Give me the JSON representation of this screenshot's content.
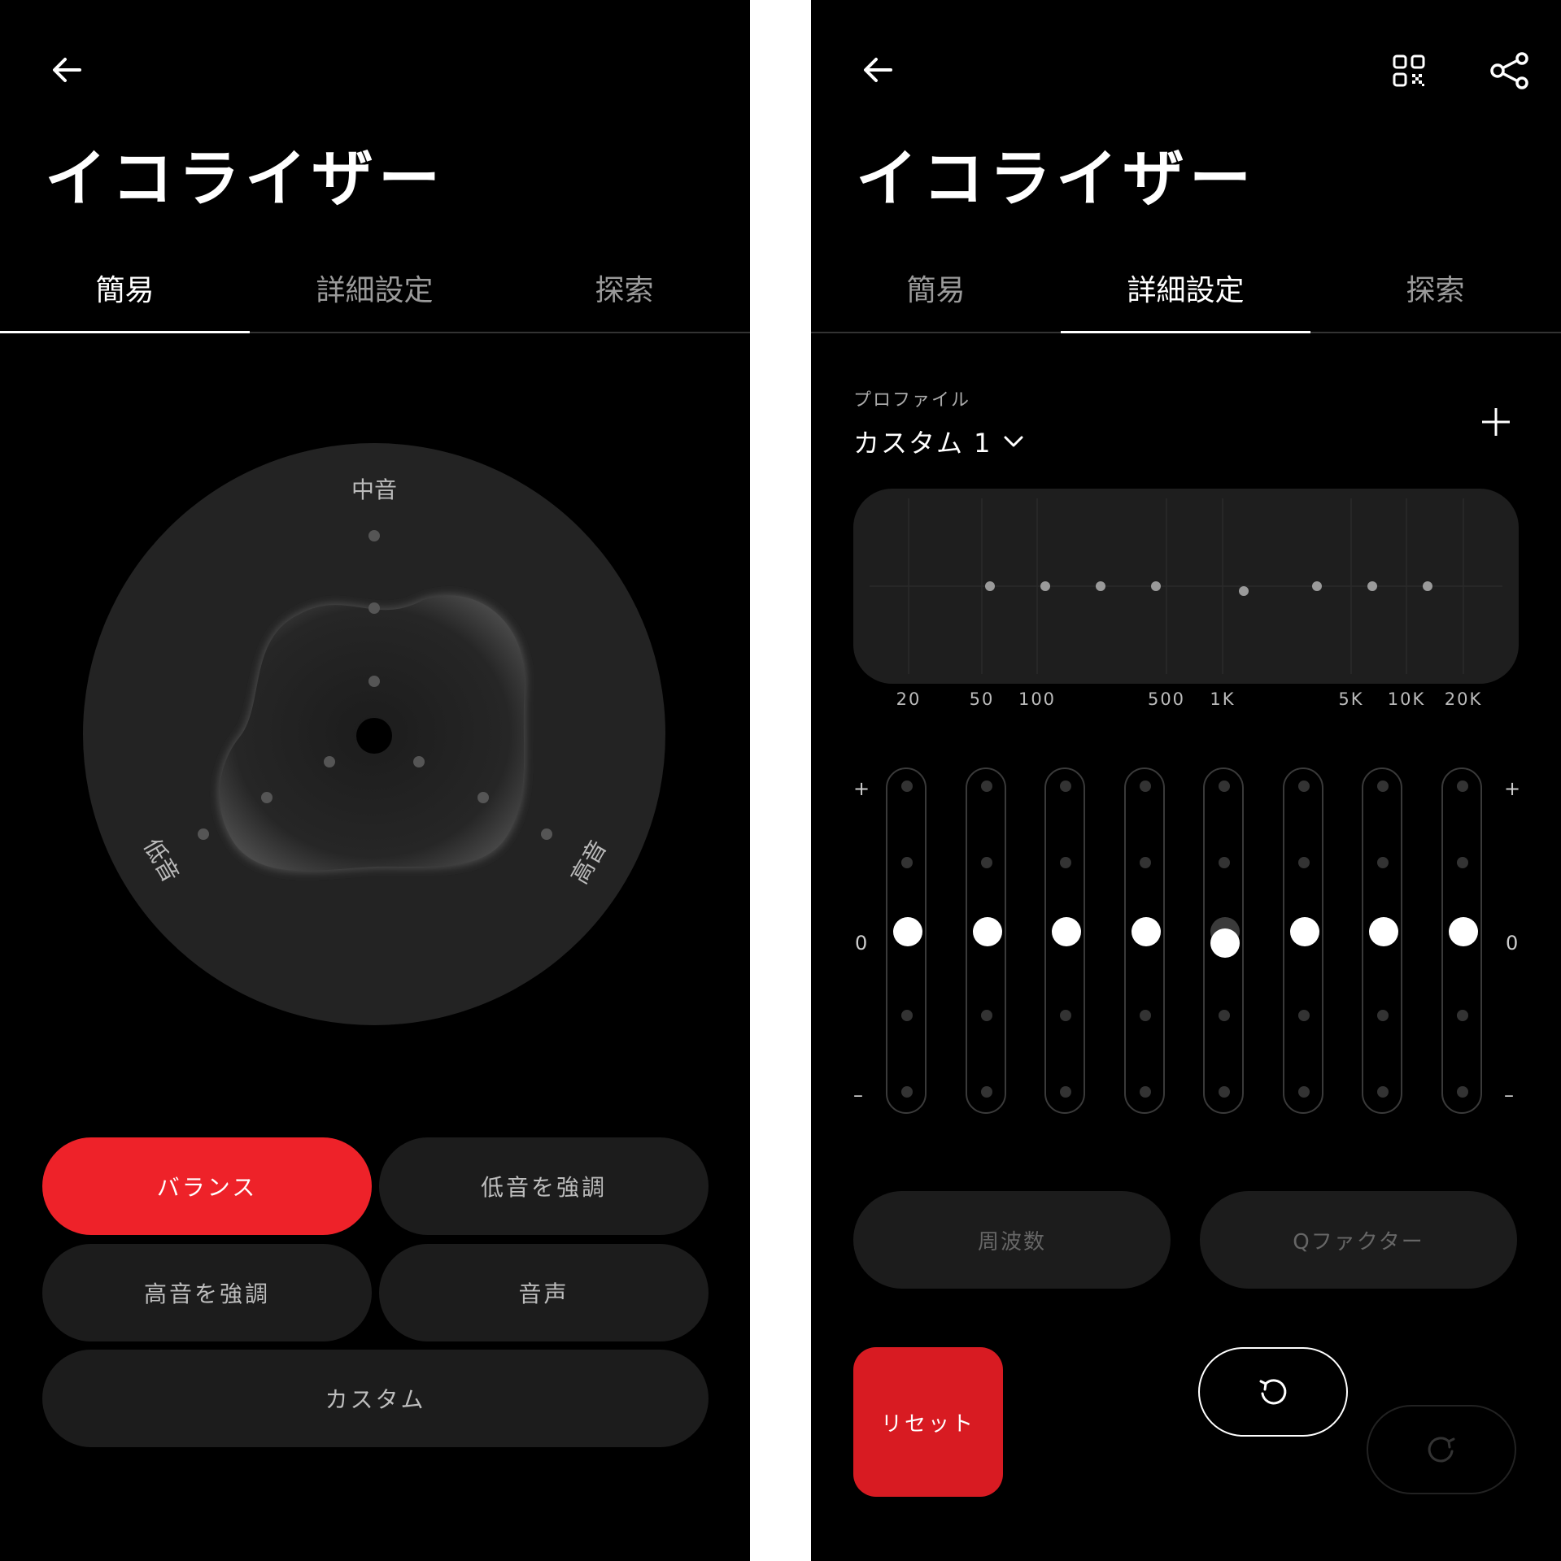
{
  "left": {
    "title": "イコライザー",
    "tabs": [
      {
        "label": "簡易"
      },
      {
        "label": "詳細設定"
      },
      {
        "label": "探索"
      }
    ],
    "active_tab": 0,
    "dial": {
      "mid_label": "中音",
      "bass_label": "低音",
      "treble_label": "高音"
    },
    "presets": [
      {
        "label": "バランス",
        "selected": true
      },
      {
        "label": "低音を強調",
        "selected": false
      },
      {
        "label": "高音を強調",
        "selected": false
      },
      {
        "label": "音声",
        "selected": false
      },
      {
        "label": "カスタム",
        "selected": false
      }
    ]
  },
  "right": {
    "title": "イコライザー",
    "tabs": [
      {
        "label": "簡易"
      },
      {
        "label": "詳細設定"
      },
      {
        "label": "探索"
      }
    ],
    "active_tab": 1,
    "profile_label": "プロファイル",
    "profile_value": "カスタム 1",
    "freq_labels": [
      "20",
      "50",
      "100",
      "500",
      "1K",
      "5K",
      "10K",
      "20K"
    ],
    "gain_labels": {
      "plus": "+",
      "zero": "0",
      "minus": "–"
    },
    "bands": [
      {
        "gain": 0
      },
      {
        "gain": 0
      },
      {
        "gain": 0
      },
      {
        "gain": 0
      },
      {
        "gain": -0.15
      },
      {
        "gain": 0
      },
      {
        "gain": 0
      },
      {
        "gain": 0
      }
    ],
    "frequency_button": "周波数",
    "qfactor_button": "Qファクター",
    "reset_button": "リセット",
    "icons": {
      "back": "back-arrow-icon",
      "qr": "qr-code-icon",
      "share": "share-icon",
      "add": "plus-icon",
      "undo": "undo-icon",
      "redo": "redo-icon",
      "chevron": "chevron-down-icon"
    },
    "accent": "#ee2229"
  }
}
